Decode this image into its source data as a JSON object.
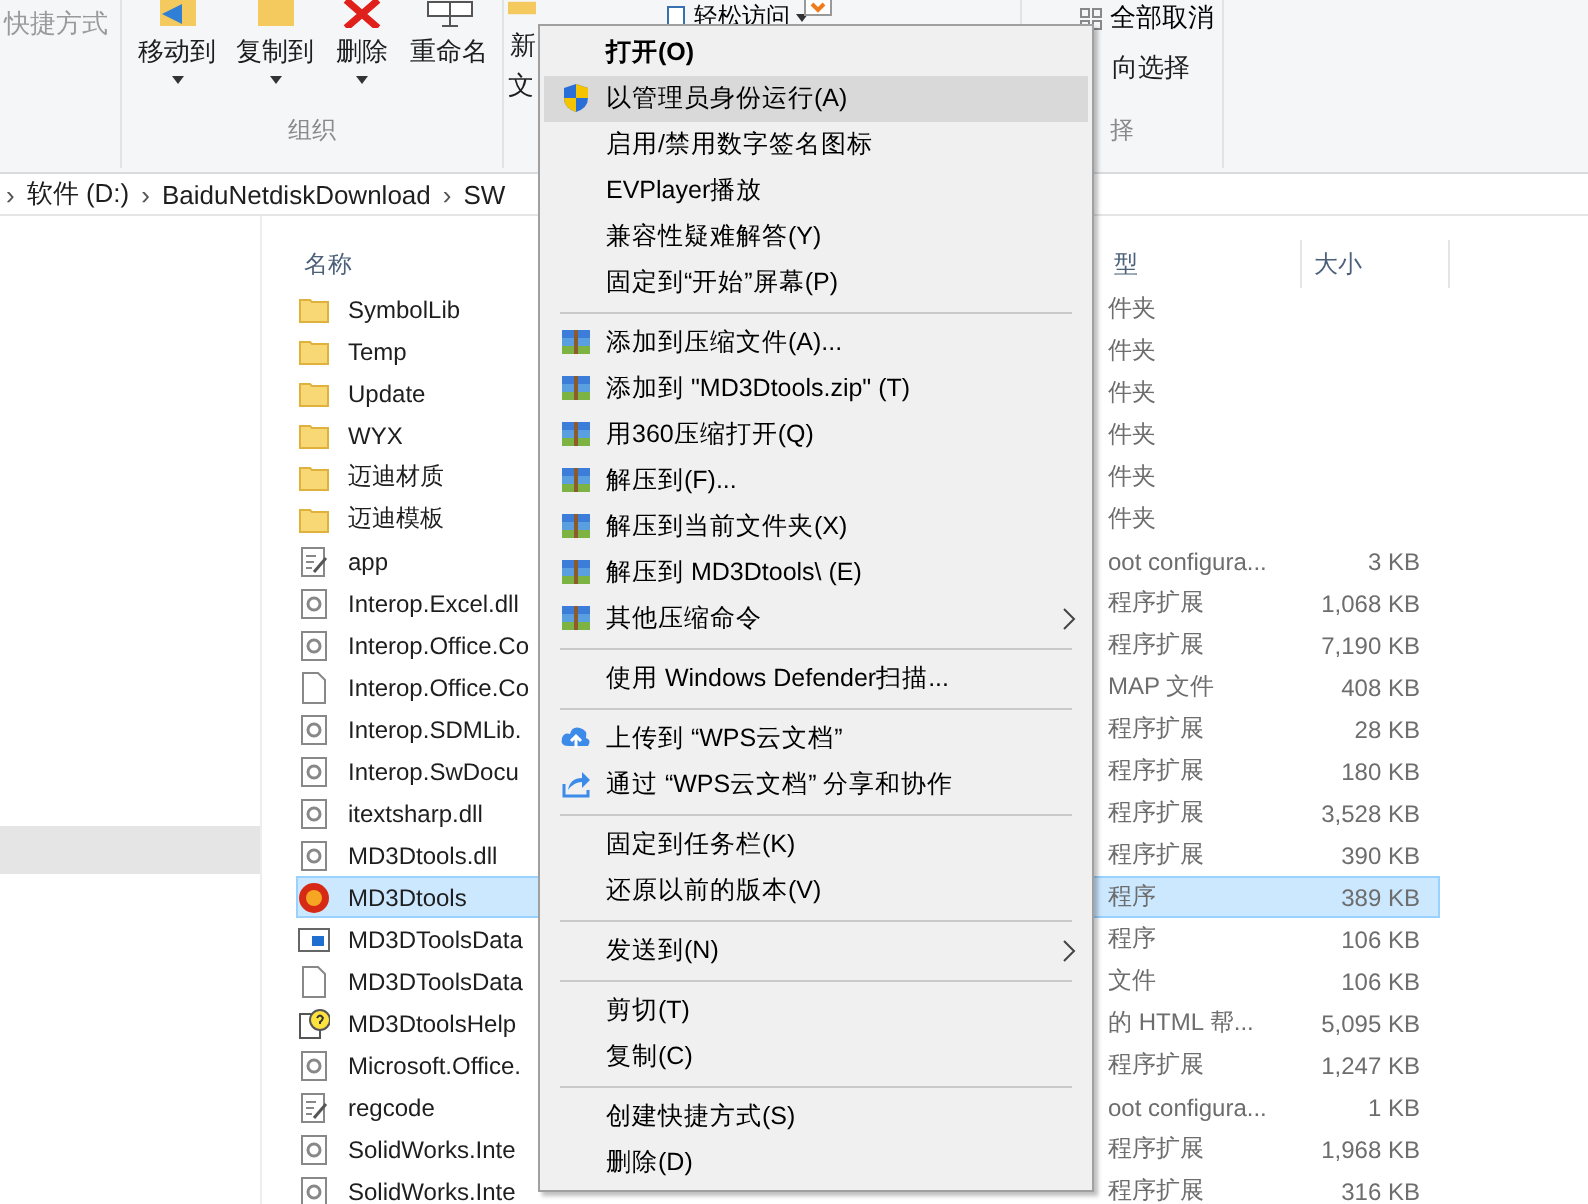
{
  "ribbon": {
    "shortcut_label": "快捷方式",
    "buttons": [
      {
        "label": "移动到",
        "kind": "move",
        "dropdown": true
      },
      {
        "label": "复制到",
        "kind": "copy",
        "dropdown": true
      },
      {
        "label": "删除",
        "kind": "delete",
        "dropdown": true
      },
      {
        "label": "重命名",
        "kind": "rename",
        "dropdown": false
      }
    ],
    "group_label": "组织",
    "new_label_top": "新",
    "new_label_bottom": "文",
    "easy_access": "轻松访问",
    "select_none": "全部取消",
    "invert_selection": "向选择",
    "select_group_label": "择"
  },
  "address": {
    "separator": "›",
    "segments": [
      "软件 (D:)",
      "BaiduNetdiskDownload",
      "SW"
    ]
  },
  "columns": {
    "name": "名称",
    "type": "型",
    "size": "大小"
  },
  "files": [
    {
      "name": "SymbolLib",
      "kind": "folder",
      "type": "件夹",
      "selected": false
    },
    {
      "name": "Temp",
      "kind": "folder",
      "type": "件夹",
      "selected": false
    },
    {
      "name": "Update",
      "kind": "folder",
      "type": "件夹",
      "selected": false
    },
    {
      "name": "WYX",
      "kind": "folder",
      "type": "件夹",
      "selected": false
    },
    {
      "name": "迈迪材质",
      "kind": "folder",
      "type": "件夹",
      "selected": false
    },
    {
      "name": "迈迪模板",
      "kind": "folder",
      "type": "件夹",
      "selected": false
    },
    {
      "name": "app",
      "kind": "config",
      "type": "oot configura...",
      "size": "3 KB",
      "selected": false
    },
    {
      "name": "Interop.Excel.dll",
      "kind": "dll",
      "type": "程序扩展",
      "size": "1,068 KB",
      "selected": false
    },
    {
      "name": "Interop.Office.Co",
      "kind": "dll",
      "type": "程序扩展",
      "size": "7,190 KB",
      "selected": false
    },
    {
      "name": "Interop.Office.Co",
      "kind": "file",
      "type": "MAP 文件",
      "size": "408 KB",
      "selected": false
    },
    {
      "name": "Interop.SDMLib.",
      "kind": "dll",
      "type": "程序扩展",
      "size": "28 KB",
      "selected": false
    },
    {
      "name": "Interop.SwDocu",
      "kind": "dll",
      "type": "程序扩展",
      "size": "180 KB",
      "selected": false
    },
    {
      "name": "itextsharp.dll",
      "kind": "dll",
      "type": "程序扩展",
      "size": "3,528 KB",
      "selected": false
    },
    {
      "name": "MD3Dtools.dll",
      "kind": "dll",
      "type": "程序扩展",
      "size": "390 KB",
      "selected": false
    },
    {
      "name": "MD3Dtools",
      "kind": "app",
      "type": "程序",
      "size": "389 KB",
      "selected": true
    },
    {
      "name": "MD3DToolsData",
      "kind": "window",
      "type": "程序",
      "size": "106 KB",
      "selected": false
    },
    {
      "name": "MD3DToolsData",
      "kind": "file",
      "type": "文件",
      "size": "106 KB",
      "selected": false
    },
    {
      "name": "MD3DtoolsHelp",
      "kind": "help",
      "type": "的 HTML 帮...",
      "size": "5,095 KB",
      "selected": false
    },
    {
      "name": "Microsoft.Office.",
      "kind": "dll",
      "type": "程序扩展",
      "size": "1,247 KB",
      "selected": false
    },
    {
      "name": "regcode",
      "kind": "config",
      "type": "oot configura...",
      "size": "1 KB",
      "selected": false
    },
    {
      "name": "SolidWorks.Inte",
      "kind": "dll",
      "type": "程序扩展",
      "size": "1,968 KB",
      "selected": false
    },
    {
      "name": "SolidWorks.Inte",
      "kind": "dll",
      "type": "程序扩展",
      "size": "316 KB",
      "selected": false
    }
  ],
  "context_menu": [
    {
      "kind": "plain",
      "label": "打开(O)",
      "bold": true,
      "selected": false,
      "submenu": false
    },
    {
      "kind": "shield",
      "label": "以管理员身份运行(A)",
      "bold": false,
      "selected": true,
      "submenu": false
    },
    {
      "kind": "plain",
      "label": "启用/禁用数字签名图标",
      "bold": false,
      "selected": false,
      "submenu": false
    },
    {
      "kind": "plain",
      "label": "EVPlayer播放",
      "bold": false,
      "selected": false,
      "submenu": false
    },
    {
      "kind": "plain",
      "label": "兼容性疑难解答(Y)",
      "bold": false,
      "selected": false,
      "submenu": false
    },
    {
      "kind": "plain",
      "label": "固定到“开始”屏幕(P)",
      "bold": false,
      "selected": false,
      "submenu": false
    },
    {
      "kind": "separator"
    },
    {
      "kind": "archive",
      "label": "添加到压缩文件(A)...",
      "bold": false,
      "selected": false,
      "submenu": false
    },
    {
      "kind": "archive",
      "label": "添加到 \"MD3Dtools.zip\" (T)",
      "bold": false,
      "selected": false,
      "submenu": false
    },
    {
      "kind": "archive",
      "label": "用360压缩打开(Q)",
      "bold": false,
      "selected": false,
      "submenu": false
    },
    {
      "kind": "archive",
      "label": "解压到(F)...",
      "bold": false,
      "selected": false,
      "submenu": false
    },
    {
      "kind": "archive",
      "label": "解压到当前文件夹(X)",
      "bold": false,
      "selected": false,
      "submenu": false
    },
    {
      "kind": "archive",
      "label": "解压到 MD3Dtools\\ (E)",
      "bold": false,
      "selected": false,
      "submenu": false
    },
    {
      "kind": "archive",
      "label": "其他压缩命令",
      "bold": false,
      "selected": false,
      "submenu": true
    },
    {
      "kind": "separator"
    },
    {
      "kind": "plain",
      "label": "使用 Windows Defender扫描...",
      "bold": false,
      "selected": false,
      "submenu": false
    },
    {
      "kind": "separator"
    },
    {
      "kind": "cloud",
      "label": "上传到 “WPS云文档”",
      "bold": false,
      "selected": false,
      "submenu": false
    },
    {
      "kind": "share",
      "label": "通过 “WPS云文档” 分享和协作",
      "bold": false,
      "selected": false,
      "submenu": false
    },
    {
      "kind": "separator"
    },
    {
      "kind": "plain",
      "label": "固定到任务栏(K)",
      "bold": false,
      "selected": false,
      "submenu": false
    },
    {
      "kind": "plain",
      "label": "还原以前的版本(V)",
      "bold": false,
      "selected": false,
      "submenu": false
    },
    {
      "kind": "separator"
    },
    {
      "kind": "plain",
      "label": "发送到(N)",
      "bold": false,
      "selected": false,
      "submenu": true
    },
    {
      "kind": "separator"
    },
    {
      "kind": "plain",
      "label": "剪切(T)",
      "bold": false,
      "selected": false,
      "submenu": false
    },
    {
      "kind": "plain",
      "label": "复制(C)",
      "bold": false,
      "selected": false,
      "submenu": false
    },
    {
      "kind": "separator"
    },
    {
      "kind": "plain",
      "label": "创建快捷方式(S)",
      "bold": false,
      "selected": false,
      "submenu": false
    },
    {
      "kind": "plain",
      "label": "删除(D)",
      "bold": false,
      "selected": false,
      "submenu": false
    }
  ]
}
